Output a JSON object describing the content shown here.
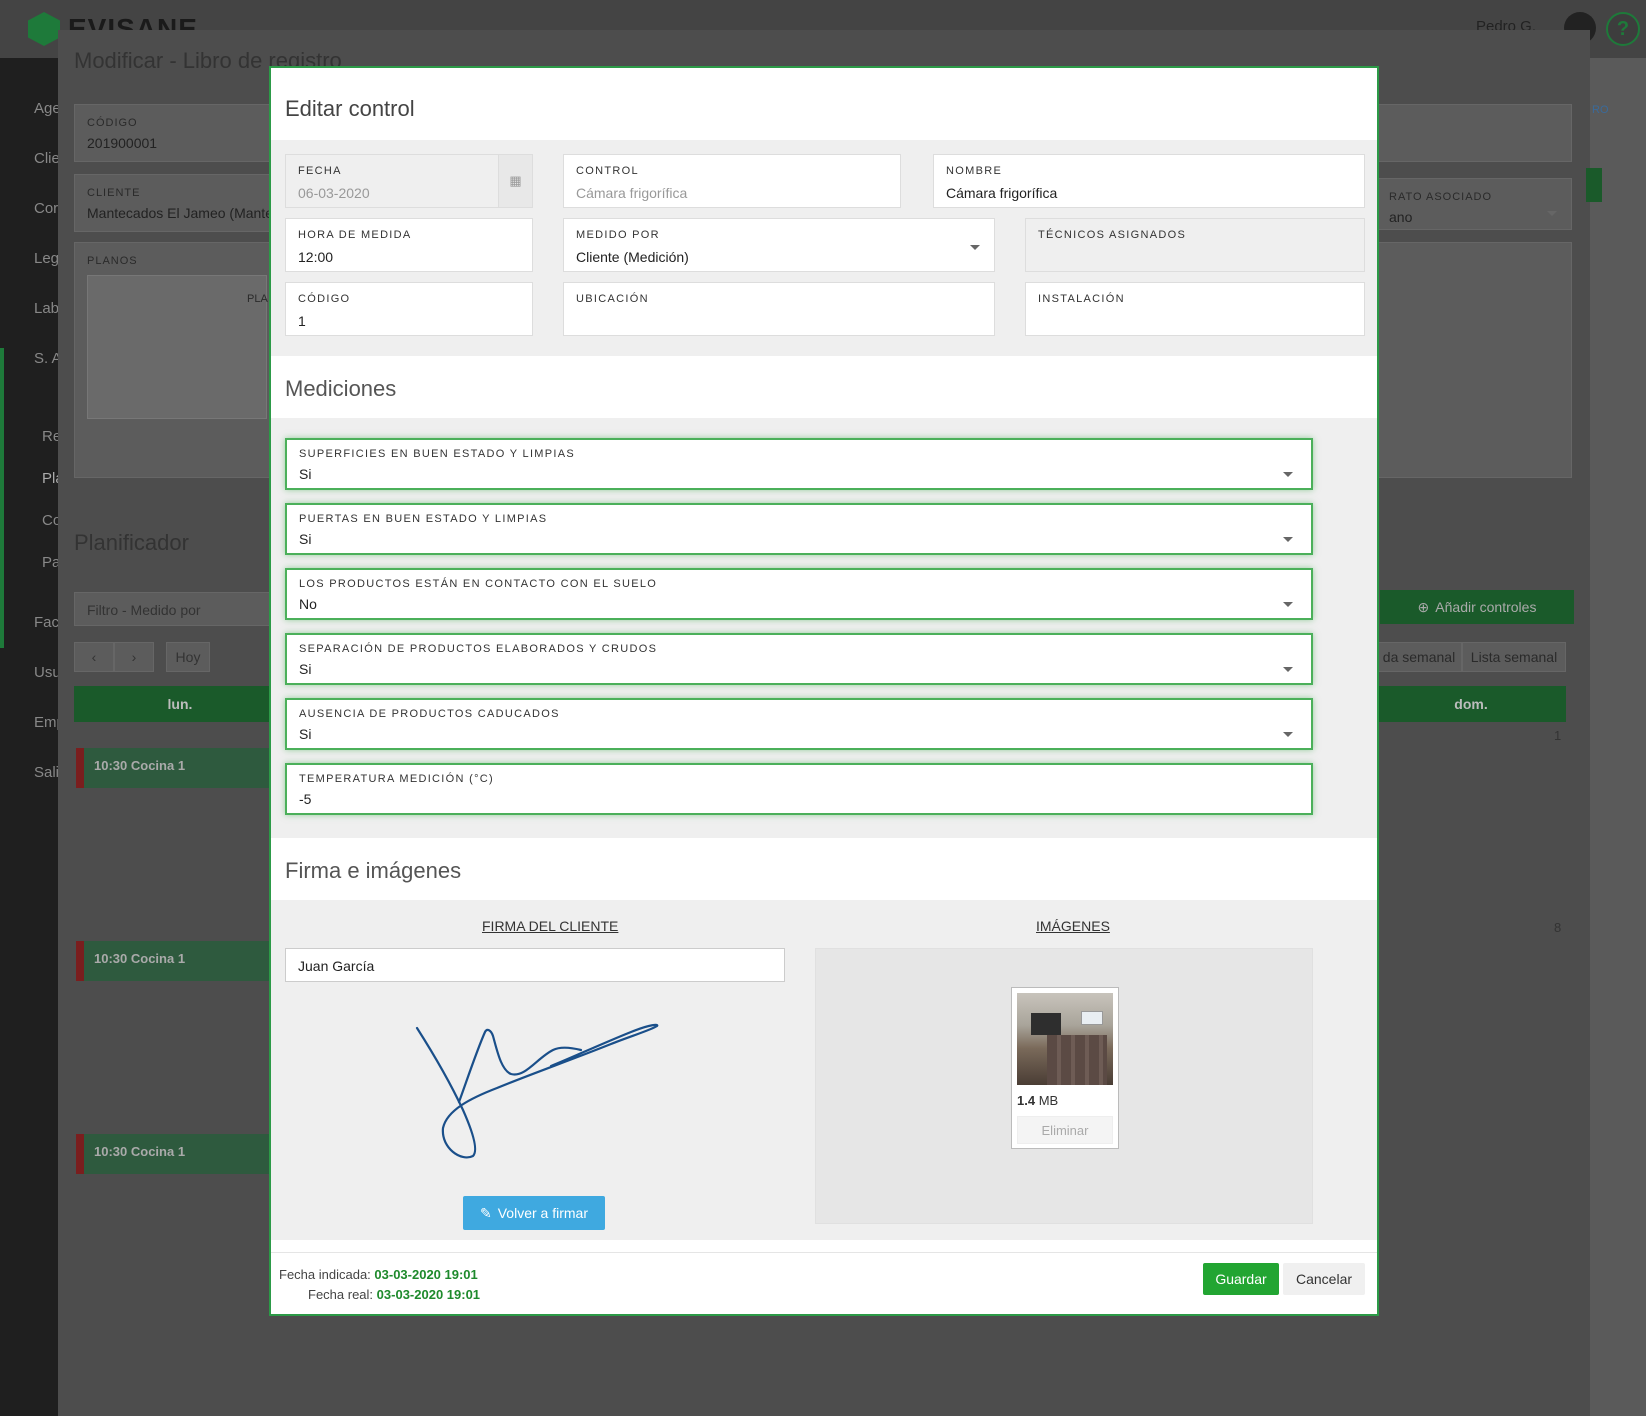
{
  "app": {
    "brand": "EVISANE",
    "user": "Pedro G.",
    "help": "?"
  },
  "sidebar": {
    "items": [
      "Age",
      "Clie",
      "Cor",
      "Leg",
      "Lab",
      "S. A",
      "Re",
      "Pla",
      "Co",
      "Pa",
      "Fac",
      "Usu",
      "Emp",
      "Sali"
    ]
  },
  "background": {
    "title": "Modificar - Libro de registro",
    "codigo_label": "CÓDIGO",
    "codigo_value": "201900001",
    "cliente_label": "CLIENTE",
    "cliente_value": "Mantecados El Jameo (Mante",
    "planos_label": "PLANOS",
    "planos_side": "PLA",
    "contrato_label": "RATO ASOCIADO",
    "contrato_value": "ano",
    "right_link": "RO",
    "planificador": "Planificador",
    "filtro_placeholder": "Filtro - Medido por",
    "hoy": "Hoy",
    "prev": "‹",
    "next": "›",
    "add_controls": "Añadir controles",
    "semanal_btn": "da semanal",
    "lista_btn": "Lista semanal",
    "day_lun": "lun.",
    "day_dom": "dom.",
    "day_1": "1",
    "day_8": "8",
    "events": [
      "10:30 Cocina 1",
      "10:30 Cocina 1",
      "10:30 Cocina 1"
    ]
  },
  "modal": {
    "title": "Editar control",
    "fecha_label": "FECHA",
    "fecha_value": "06-03-2020",
    "control_label": "CONTROL",
    "control_value": "Cámara frigorífica",
    "nombre_label": "NOMBRE",
    "nombre_value": "Cámara frigorífica",
    "hora_label": "HORA DE MEDIDA",
    "hora_value": "12:00",
    "medido_label": "MEDIDO POR",
    "medido_value": "Cliente (Medición)",
    "tecnicos_label": "TÉCNICOS ASIGNADOS",
    "codigo_label": "CÓDIGO",
    "codigo_value": "1",
    "ubicacion_label": "UBICACIÓN",
    "instalacion_label": "INSTALACIÓN",
    "mediciones_title": "Mediciones",
    "mediciones": [
      {
        "label": "SUPERFICIES EN BUEN ESTADO Y LIMPIAS",
        "value": "Si"
      },
      {
        "label": "PUERTAS EN BUEN ESTADO Y LIMPIAS",
        "value": "Si"
      },
      {
        "label": "LOS PRODUCTOS ESTÁN EN CONTACTO CON EL SUELO",
        "value": "No"
      },
      {
        "label": "SEPARACIÓN DE PRODUCTOS ELABORADOS Y CRUDOS",
        "value": "Si"
      },
      {
        "label": "AUSENCIA DE PRODUCTOS CADUCADOS",
        "value": "Si"
      },
      {
        "label": "TEMPERATURA MEDICIÓN (°C)",
        "value": "-5"
      }
    ],
    "firma_title": "Firma e imágenes",
    "firma_head": "FIRMA DEL CLIENTE",
    "imagenes_head": "IMÁGENES",
    "signer": "Juan García",
    "refirm": "Volver a firmar",
    "image_size_num": "1.4",
    "image_size_unit": "MB",
    "delete": "Eliminar",
    "fecha_indicada_label": "Fecha indicada:",
    "fecha_indicada_value": "03-03-2020 19:01",
    "fecha_real_label": "Fecha real:",
    "fecha_real_value": "03-03-2020 19:01",
    "save": "Guardar",
    "cancel": "Cancelar"
  },
  "colors": {
    "accent": "#2c9a47",
    "save": "#22a532",
    "refirm": "#3fa9e0",
    "date_value": "#1e8a2c"
  }
}
